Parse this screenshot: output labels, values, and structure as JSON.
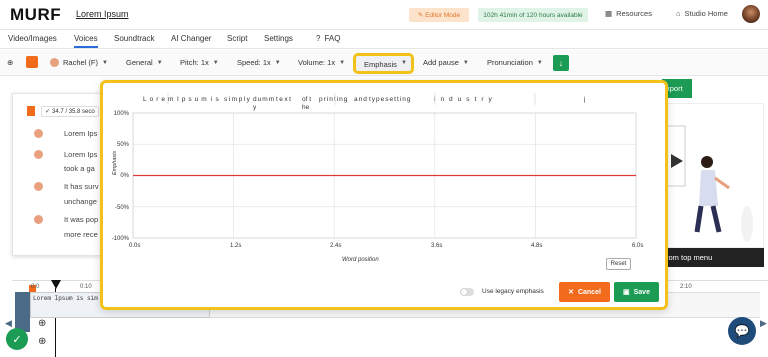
{
  "app": {
    "logo": "MURF",
    "project_title": "Lorem Ipsum",
    "editor_mode": "Editor Mode",
    "time_available": "102h 41min of 120 hours available",
    "resources": "Resources",
    "studio_home": "Studio Home"
  },
  "tabs": [
    {
      "label": "Video/Images"
    },
    {
      "label": "Voices"
    },
    {
      "label": "Soundtrack"
    },
    {
      "label": "AI Changer"
    },
    {
      "label": "Script"
    },
    {
      "label": "Settings"
    },
    {
      "label": "FAQ"
    }
  ],
  "toolbar": {
    "voice": "Rachel (F)",
    "style": "General",
    "pitch": "Pitch: 1x",
    "speed": "Speed: 1x",
    "volume": "Volume: 1x",
    "emphasis": "Emphasis",
    "add_pause": "Add pause",
    "pronunciation": "Pronunciation"
  },
  "background": {
    "block_meta": "34.7 / 35.8 seco",
    "lines": [
      "Lorem Ips",
      "Lorem Ips",
      "took a ga",
      "It has surv",
      "unchange",
      "It was pop",
      "more rece"
    ],
    "export_label": "xport",
    "top_menu_label": "rom top menu",
    "timeline_ticks": [
      "0:0",
      "0:10",
      "2:10"
    ],
    "timeline_text": "Lorem Ipsum is sim"
  },
  "emphasis_modal": {
    "words": [
      "Lorem",
      "Ipsum",
      "is",
      "simply",
      "dumm y",
      "text",
      "of t he",
      "printing",
      "and",
      "typesetting",
      "industry",
      "j"
    ],
    "chart_data": {
      "type": "line",
      "title": "",
      "xlabel": "Word position",
      "ylabel": "Emphasis",
      "x_ticks": [
        "0.0s",
        "1.2s",
        "2.4s",
        "3.6s",
        "4.8s",
        "6.0s"
      ],
      "y_ticks": [
        "100%",
        "50%",
        "0%",
        "-50%",
        "-100%"
      ],
      "ylim": [
        -100,
        100
      ],
      "xlim": [
        0,
        6
      ],
      "grid": true,
      "series": [
        {
          "x": [
            0,
            6
          ],
          "values": [
            0,
            0
          ],
          "color": "#e53935"
        }
      ]
    },
    "reset": "Reset",
    "legacy_label": "Use legacy emphasis",
    "cancel": "Cancel",
    "save": "Save"
  }
}
